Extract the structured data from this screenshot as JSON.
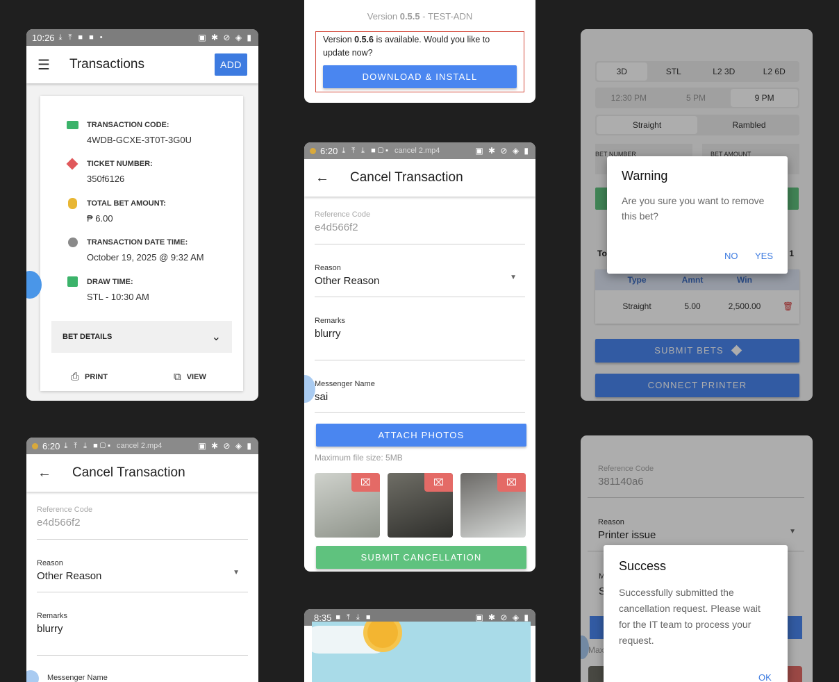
{
  "transactions_screen": {
    "status_time": "10:26",
    "title": "Transactions",
    "add_label": "ADD",
    "items": [
      {
        "label": "TRANSACTION CODE:",
        "value": "4WDB-GCXE-3T0T-3G0U"
      },
      {
        "label": "TICKET NUMBER:",
        "value": "350f6126"
      },
      {
        "label": "TOTAL BET AMOUNT:",
        "value": "₱ 6.00"
      },
      {
        "label": "TRANSACTION DATE TIME:",
        "value": "October 19, 2025 @ 9:32 AM"
      },
      {
        "label": "DRAW TIME:",
        "value": "STL - 10:30 AM"
      }
    ],
    "bet_details_label": "BET DETAILS",
    "print_label": "PRINT",
    "view_label": "VIEW"
  },
  "update_screen": {
    "version_text": "Version ",
    "version_num": "0.5.5",
    "version_env": " - TEST-ADN",
    "update_pre": "Version ",
    "update_version": "0.5.6",
    "update_post": " is available. Would you like to update now?",
    "download_label": "DOWNLOAD & INSTALL"
  },
  "cancel_screen_center": {
    "status_time": "6:20",
    "status_file": "cancel 2.mp4",
    "title": "Cancel Transaction",
    "ref_label": "Reference Code",
    "ref_value": "e4d566f2",
    "reason_label": "Reason",
    "reason_value": "Other Reason",
    "remarks_label": "Remarks",
    "remarks_value": "blurry",
    "messenger_label": "Messenger Name",
    "messenger_value": "sai",
    "attach_label": "ATTACH PHOTOS",
    "max_size": "Maximum file size: 5MB",
    "submit_label": "SUBMIT CANCELLATION"
  },
  "cancel_screen_left": {
    "status_time": "6:20",
    "status_file": "cancel 2.mp4",
    "title": "Cancel Transaction",
    "ref_label": "Reference Code",
    "ref_value": "e4d566f2",
    "reason_label": "Reason",
    "reason_value": "Other Reason",
    "remarks_label": "Remarks",
    "remarks_value": "blurry",
    "messenger_label": "Messenger Name"
  },
  "bet_screen": {
    "games": [
      "3D",
      "STL",
      "L2 3D",
      "L2 6D"
    ],
    "times": [
      "12:30 PM",
      "5 PM",
      "9 PM"
    ],
    "types": [
      "Straight",
      "Rambled"
    ],
    "bet_number_label": "BET NUMBER",
    "bet_amount_label": "BET AMOUNT",
    "table_headers": [
      "Type",
      "Amnt",
      "Win"
    ],
    "row": [
      "Straight",
      "5.00",
      "2,500.00"
    ],
    "submit_label": "SUBMIT BETS",
    "connect_label": "CONNECT PRINTER",
    "total_prefix": "To",
    "total_suffix": ": 1",
    "dialog_title": "Warning",
    "dialog_body": "Are you sure you want to remove this bet?",
    "no_label": "NO",
    "yes_label": "YES"
  },
  "bottom_center_screen": {
    "status_time": "8:35"
  },
  "success_screen": {
    "ref_label": "Reference Code",
    "ref_value": "381140a6",
    "reason_label": "Reason",
    "reason_value": "Printer issue",
    "partial_m": "M",
    "partial_s": "S",
    "partial_max": "Max",
    "dialog_title": "Success",
    "dialog_body": "Successfully submitted the cancellation request. Please wait for the IT team to process your request.",
    "ok_label": "OK"
  },
  "colors": {
    "blue": "#4a86f0",
    "green": "#5fc27e",
    "red": "#e05a5a"
  }
}
